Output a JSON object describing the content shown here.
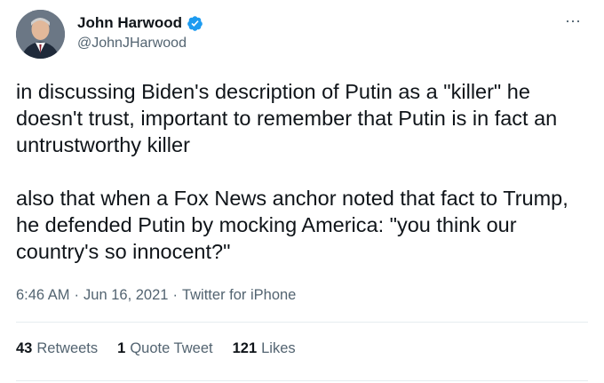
{
  "author": {
    "name": "John Harwood",
    "handle": "@JohnJHarwood",
    "verified": true
  },
  "more_icon": "⋯",
  "tweet": {
    "paragraph1": "in discussing Biden's description of Putin as a \"killer\" he doesn't trust, important to remember that Putin is in fact an untrustworthy killer",
    "paragraph2": "also that when a Fox News anchor noted that fact to Trump, he defended Putin by mocking America: \"you think our country's so innocent?\""
  },
  "meta": {
    "time": "6:46 AM",
    "separator": "·",
    "date": "Jun 16, 2021",
    "source": "Twitter for iPhone"
  },
  "stats": {
    "retweets_count": "43",
    "retweets_label": "Retweets",
    "quotes_count": "1",
    "quotes_label": "Quote Tweet",
    "likes_count": "121",
    "likes_label": "Likes"
  },
  "colors": {
    "verified_badge": "#1d9bf0",
    "secondary_text": "#536471",
    "primary_text": "#0f1419"
  }
}
